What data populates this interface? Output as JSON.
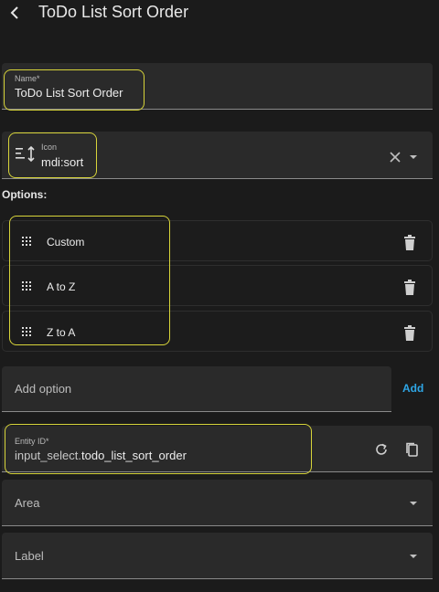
{
  "header": {
    "title": "ToDo List Sort Order",
    "back_icon": "chevron-left-icon"
  },
  "name_field": {
    "label": "Name*",
    "value": "ToDo List Sort Order"
  },
  "icon_field": {
    "label": "Icon",
    "value": "mdi:sort",
    "preview_icon": "sort-icon",
    "clear_icon": "close-icon",
    "dropdown_icon": "caret-down-icon"
  },
  "options": {
    "title": "Options:",
    "items": [
      {
        "label": "Custom"
      },
      {
        "label": "A to Z"
      },
      {
        "label": "Z to A"
      }
    ],
    "drag_icon": "drag-handle-icon",
    "delete_icon": "trash-icon"
  },
  "add_option": {
    "placeholder": "Add option",
    "button_label": "Add"
  },
  "entity_id": {
    "label": "Entity ID*",
    "prefix": "input_select.",
    "value": "todo_list_sort_order",
    "regenerate_icon": "refresh-icon",
    "copy_icon": "copy-icon"
  },
  "area": {
    "label": "Area"
  },
  "label_field": {
    "label": "Label"
  },
  "colors": {
    "background": "#1b1b1b",
    "field_background": "#2a2a2a",
    "accent": "#2ea6e6",
    "highlight": "#d7d43a"
  }
}
